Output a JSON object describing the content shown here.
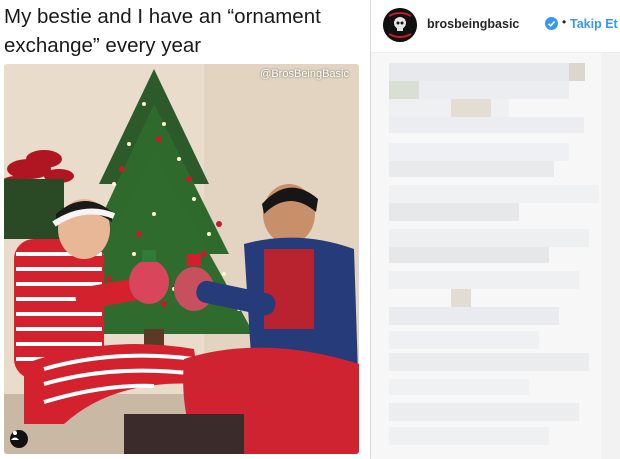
{
  "tweet": {
    "caption": "My bestie and I have an “ornament exchange” every year"
  },
  "photo": {
    "watermark": "@BrosBeingBasic",
    "user_tag_icon": "person-icon"
  },
  "instagram": {
    "username": "brosbeingbasic",
    "verified_icon": "verified-badge-icon",
    "separator": "•",
    "follow_label": "Takip Et",
    "accent_color": "#3897f0",
    "avatar_icon": "skull-logo-icon"
  }
}
